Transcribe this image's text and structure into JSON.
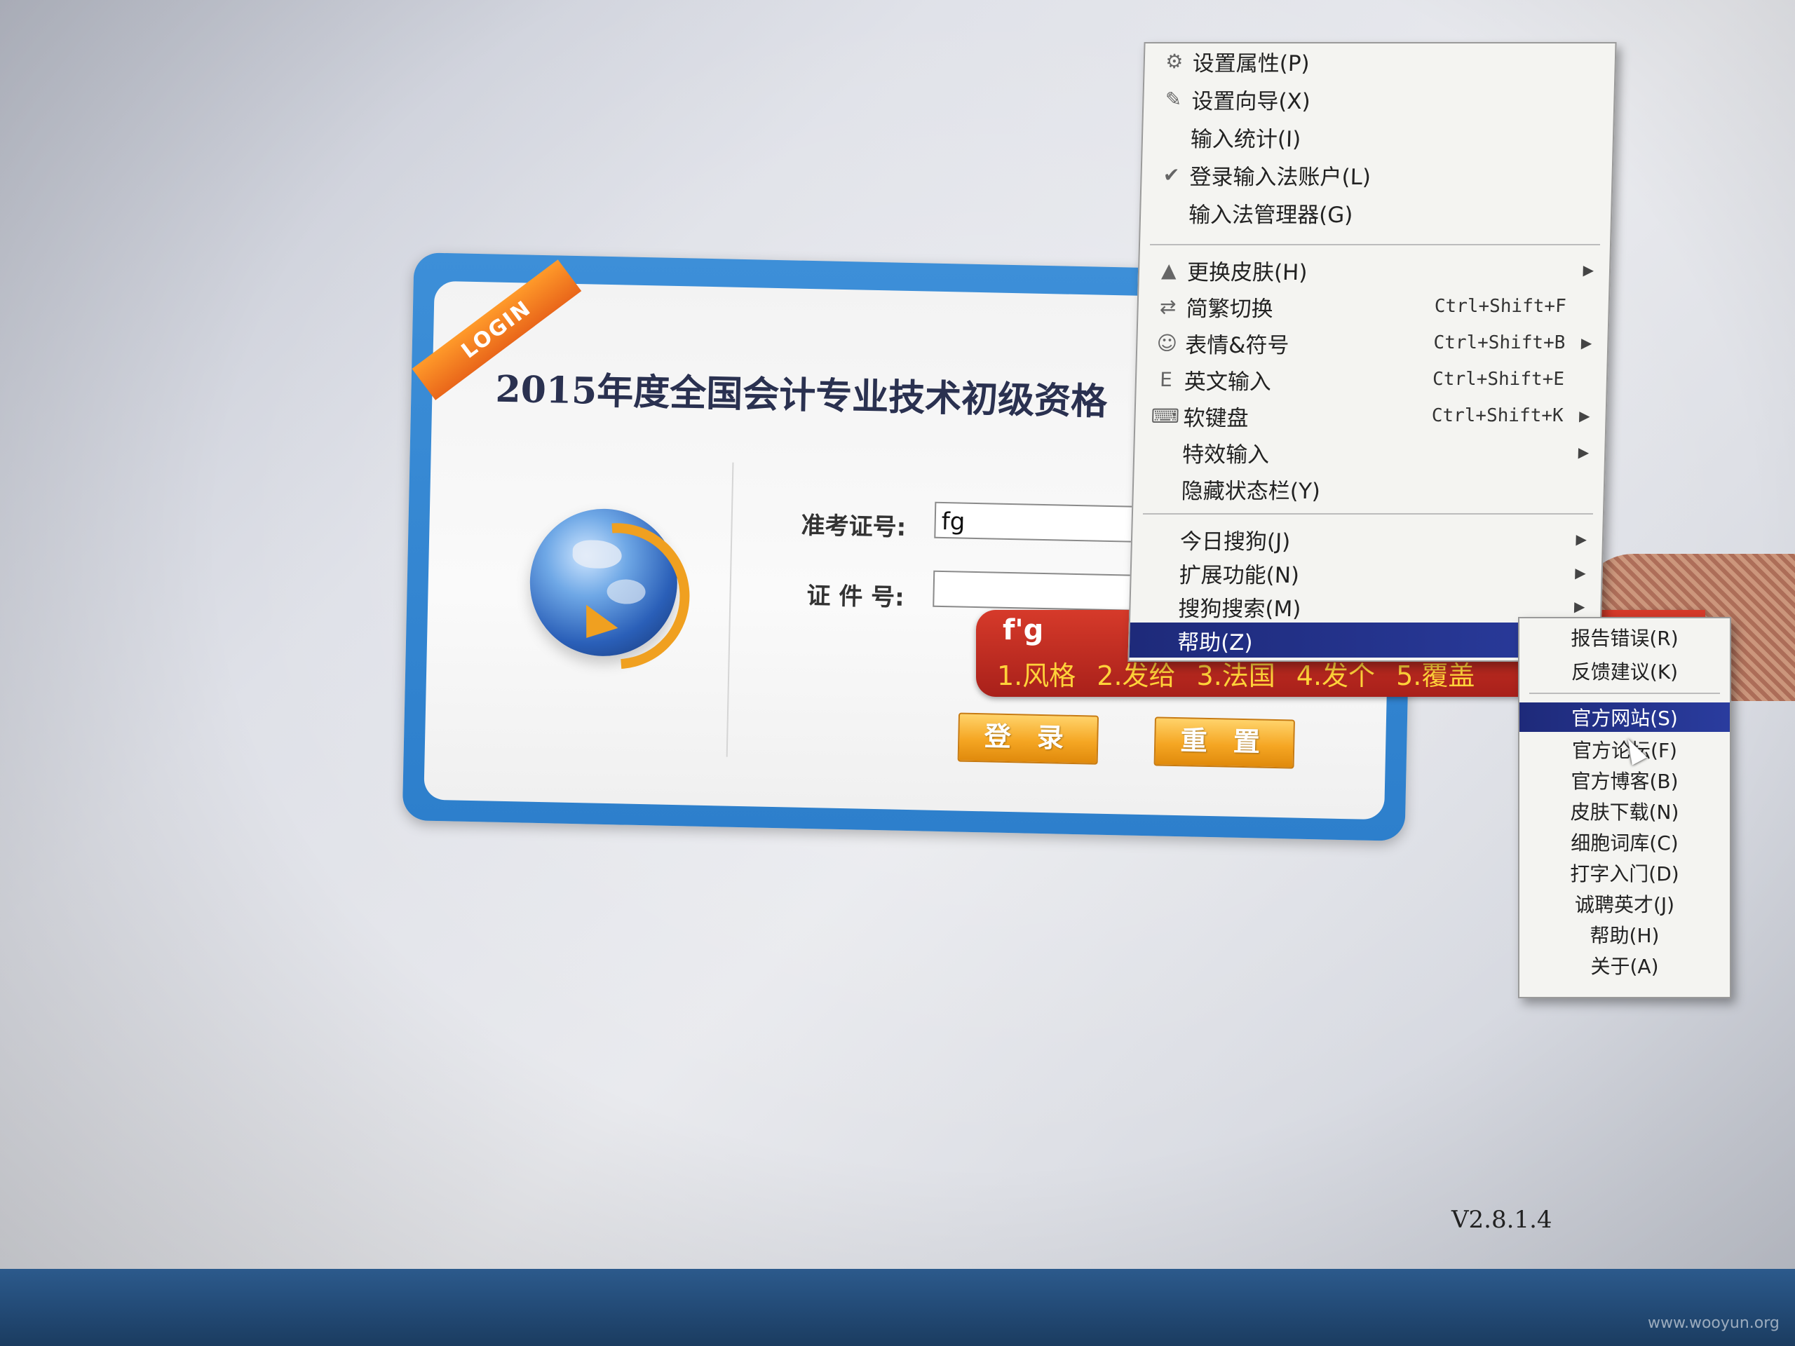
{
  "login": {
    "ribbon": "LOGIN",
    "title": "2015年度全国会计专业技术初级资格",
    "ticket_label": "准考证号:",
    "ticket_value": "fg",
    "id_label": "证 件 号:",
    "id_value": "",
    "login_button": "登 录",
    "reset_button": "重 置"
  },
  "ime": {
    "composition": "f'g",
    "candidates": [
      "1.风格",
      "2.发给",
      "3.法国",
      "4.发个",
      "5.覆盖"
    ]
  },
  "context_menu": {
    "items": [
      {
        "label": "设置属性(P)",
        "icon": "gear-icon"
      },
      {
        "label": "设置向导(X)",
        "icon": "wand-icon"
      },
      {
        "label": "输入统计(I)",
        "icon": ""
      },
      {
        "label": "登录输入法账户(L)",
        "icon": "check-circle-icon"
      },
      {
        "label": "输入法管理器(G)",
        "icon": ""
      },
      {
        "label": "更换皮肤(H)",
        "icon": "skin-icon",
        "submenu": true
      },
      {
        "label": "简繁切换",
        "icon": "switch-icon",
        "accel": "Ctrl+Shift+F"
      },
      {
        "label": "表情&符号",
        "icon": "smiley-icon",
        "accel": "Ctrl+Shift+B",
        "submenu": true
      },
      {
        "label": "英文输入",
        "icon": "english-icon",
        "accel": "Ctrl+Shift+E"
      },
      {
        "label": "软键盘",
        "icon": "keyboard-icon",
        "accel": "Ctrl+Shift+K",
        "submenu": true
      },
      {
        "label": "特效输入",
        "icon": "",
        "submenu": true
      },
      {
        "label": "隐藏状态栏(Y)",
        "icon": ""
      },
      {
        "label": "今日搜狗(J)",
        "icon": "",
        "submenu": true
      },
      {
        "label": "扩展功能(N)",
        "icon": "",
        "submenu": true
      },
      {
        "label": "搜狗搜索(M)",
        "icon": "",
        "submenu": true
      },
      {
        "label": "帮助(Z)",
        "icon": "",
        "submenu": true,
        "highlighted": true
      }
    ]
  },
  "help_submenu": {
    "items": [
      {
        "label": "报告错误(R)"
      },
      {
        "label": "反馈建议(K)"
      },
      {
        "label": "官方网站(S)",
        "highlighted": true
      },
      {
        "label": "官方论坛(F)"
      },
      {
        "label": "官方博客(B)"
      },
      {
        "label": "皮肤下载(N)"
      },
      {
        "label": "细胞词库(C)"
      },
      {
        "label": "打字入门(D)"
      },
      {
        "label": "诚聘英才(J)"
      },
      {
        "label": "帮助(H)"
      },
      {
        "label": "关于(A)"
      }
    ]
  },
  "footer": {
    "version": "V2.8.1.4",
    "watermark": "www.wooyun.org"
  },
  "colors": {
    "frame_blue": "#2d7fcc",
    "ribbon_orange": "#e9661a",
    "button_orange": "#f5a623",
    "ime_red": "#c0291f",
    "ime_candidate": "#ffd23a",
    "menu_highlight": "#1e2a7a"
  }
}
